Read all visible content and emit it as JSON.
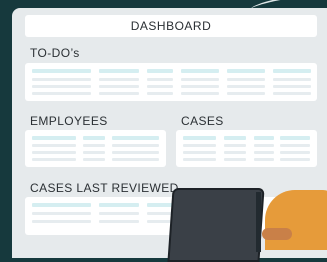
{
  "header": {
    "title": "DASHBOARD"
  },
  "sections": {
    "todos": {
      "title": "TO-DO’s"
    },
    "employees": {
      "title": "EMPLOYEES"
    },
    "cases": {
      "title": "CASES"
    },
    "cases_last_reviewed": {
      "title": "CASES LAST REVIEWED"
    }
  },
  "colors": {
    "background": "#16393d",
    "panel": "#e6eaec",
    "card": "#ffffff",
    "placeholder_header": "#d5eef1",
    "placeholder_row": "#e6ecef"
  }
}
